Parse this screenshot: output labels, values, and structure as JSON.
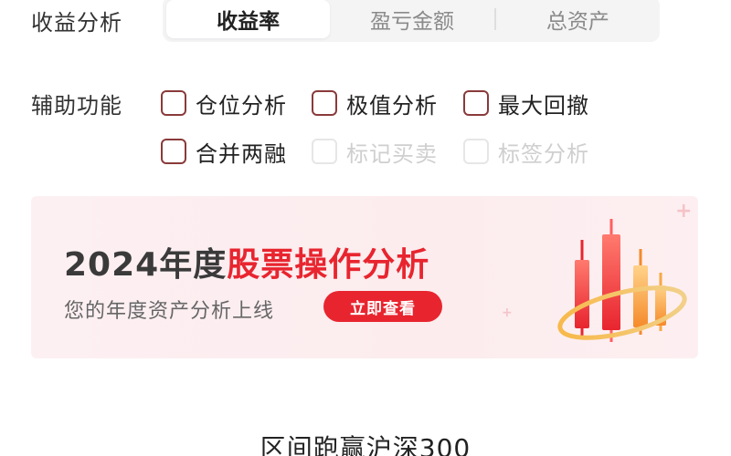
{
  "analysis": {
    "label": "收益分析",
    "tabs": [
      {
        "label": "收益率",
        "active": true
      },
      {
        "label": "盈亏金额",
        "active": false
      },
      {
        "label": "总资产",
        "active": false
      }
    ]
  },
  "aux": {
    "label": "辅助功能",
    "options": [
      {
        "label": "仓位分析",
        "enabled": true,
        "checked": false
      },
      {
        "label": "极值分析",
        "enabled": true,
        "checked": false
      },
      {
        "label": "最大回撤",
        "enabled": true,
        "checked": false
      },
      {
        "label": "合并两融",
        "enabled": true,
        "checked": false
      },
      {
        "label": "标记买卖",
        "enabled": false,
        "checked": false
      },
      {
        "label": "标签分析",
        "enabled": false,
        "checked": false
      }
    ]
  },
  "banner": {
    "title_prefix": "2024年度",
    "title_highlight": "股票操作分析",
    "subtitle": "您的年度资产分析上线",
    "button_label": "立即查看",
    "graphic_icon": "candlestick-chart-icon",
    "accent_color": "#e8252f"
  },
  "bottom": {
    "text": "区间跑赢沪深300"
  },
  "colors": {
    "checkbox_border": "#8a3a3a",
    "disabled_text": "#cfcfcf",
    "banner_bg": "#fdf0f2"
  }
}
